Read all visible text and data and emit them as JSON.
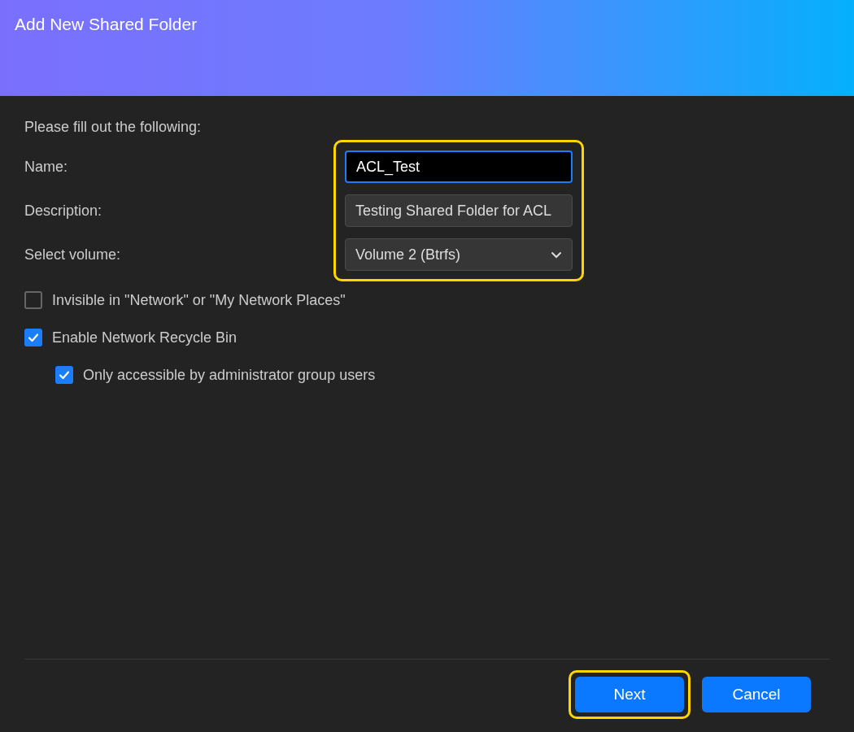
{
  "window": {
    "title": "Add New Shared Folder"
  },
  "intro": "Please fill out the following:",
  "form": {
    "highlighted": true,
    "fields": [
      {
        "kind": "text",
        "label": "Name:",
        "value": "ACL_Test",
        "focused": true
      },
      {
        "kind": "text",
        "label": "Description:",
        "value": "Testing Shared Folder for ACL",
        "focused": false
      },
      {
        "kind": "select",
        "label": "Select volume:",
        "value": "Volume 2 (Btrfs)",
        "focused": false
      }
    ]
  },
  "checkboxes": [
    {
      "label": "Invisible in \"Network\" or \"My Network Places\"",
      "checked": false
    },
    {
      "label": "Enable Network Recycle Bin",
      "checked": true,
      "children": [
        {
          "label": "Only accessible by administrator group users",
          "checked": true
        }
      ]
    }
  ],
  "buttons": [
    {
      "label": "Next",
      "highlighted": true
    },
    {
      "label": "Cancel",
      "highlighted": false
    }
  ]
}
